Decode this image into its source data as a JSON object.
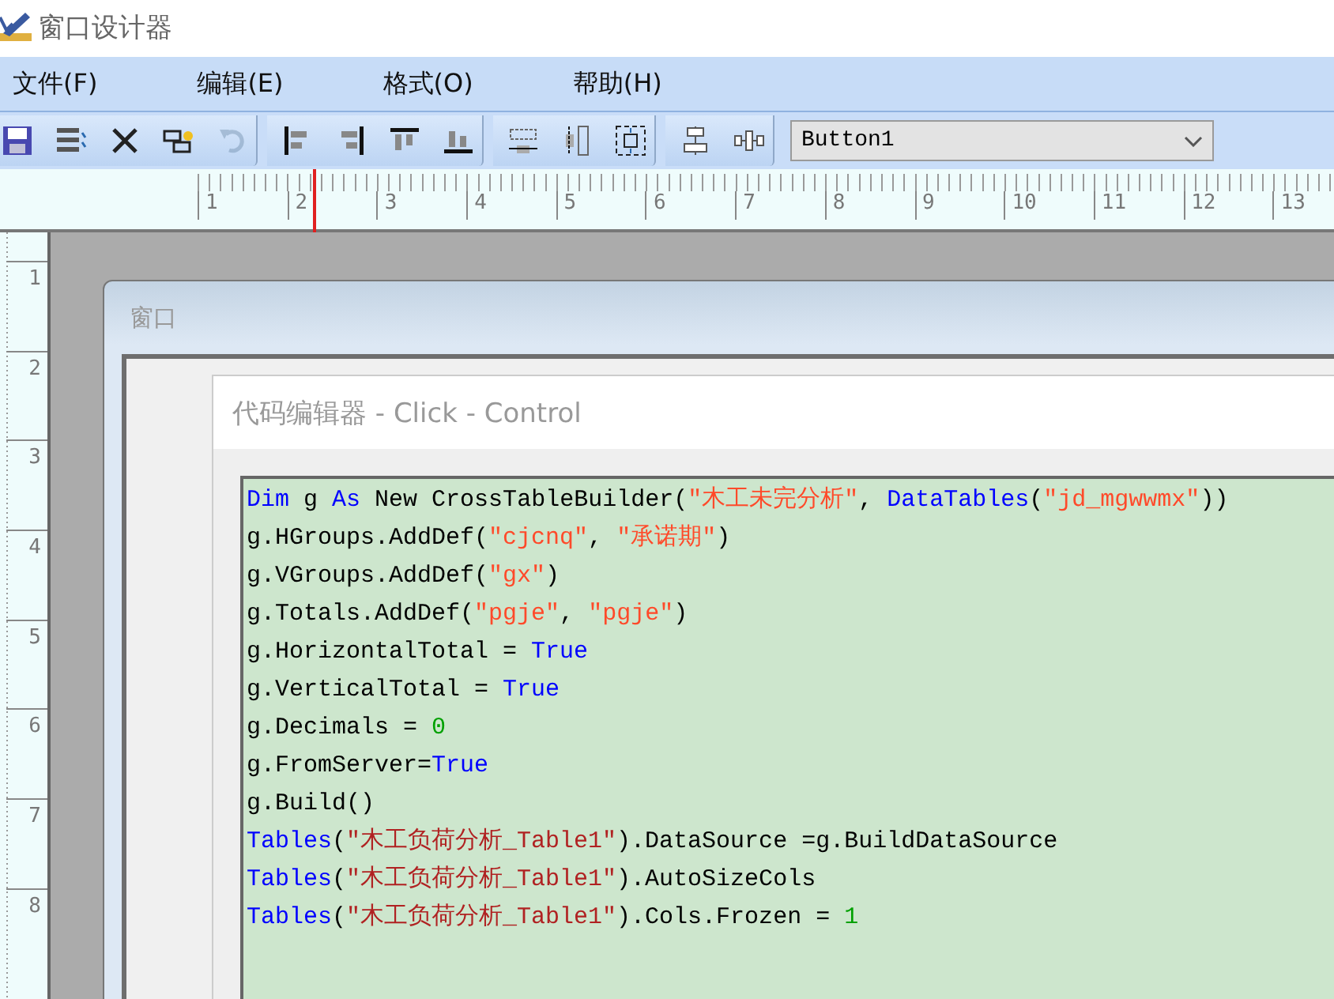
{
  "window": {
    "title": "窗口设计器"
  },
  "menu": [
    {
      "label": "文件(F)"
    },
    {
      "label": "编辑(E)"
    },
    {
      "label": "格式(O)"
    },
    {
      "label": "帮助(H)"
    }
  ],
  "toolbar": [
    [
      {
        "kind": "save",
        "disabled": false
      },
      {
        "kind": "properties",
        "disabled": false
      },
      {
        "kind": "delete",
        "disabled": false
      },
      {
        "kind": "tab-order",
        "disabled": false
      },
      {
        "kind": "undo",
        "disabled": true
      }
    ],
    [
      {
        "kind": "align-left",
        "disabled": false
      },
      {
        "kind": "align-right",
        "disabled": false
      },
      {
        "kind": "align-top",
        "disabled": false
      },
      {
        "kind": "align-bottom",
        "disabled": false
      }
    ],
    [
      {
        "kind": "same-width",
        "disabled": false
      },
      {
        "kind": "same-height",
        "disabled": false
      },
      {
        "kind": "same-size",
        "disabled": false
      }
    ],
    [
      {
        "kind": "center-vertical",
        "disabled": false
      },
      {
        "kind": "center-horizontal",
        "disabled": false
      }
    ]
  ],
  "control_selector": {
    "value": "Button1"
  },
  "ruler": {
    "horizontal": [
      "1",
      "2",
      "3",
      "4",
      "5",
      "6",
      "7",
      "8",
      "9",
      "10",
      "11",
      "12",
      "13"
    ],
    "vertical": [
      "1",
      "2",
      "3",
      "4",
      "5",
      "6",
      "7",
      "8"
    ]
  },
  "form": {
    "title": "窗口"
  },
  "code_editor": {
    "title": "代码编辑器 - Click - Control",
    "lines": [
      [
        {
          "kind": "keyword",
          "text": "Dim"
        },
        {
          "kind": "plain",
          "text": " g "
        },
        {
          "kind": "keyword",
          "text": "As"
        },
        {
          "kind": "plain",
          "text": " New CrossTableBuilder("
        },
        {
          "kind": "string",
          "text": "\"木工未完分析\""
        },
        {
          "kind": "plain",
          "text": ", "
        },
        {
          "kind": "keyword",
          "text": "DataTables"
        },
        {
          "kind": "plain",
          "text": "("
        },
        {
          "kind": "string",
          "text": "\"jd_mgwwmx\""
        },
        {
          "kind": "plain",
          "text": "))"
        }
      ],
      [
        {
          "kind": "plain",
          "text": "g.HGroups.AddDef("
        },
        {
          "kind": "string",
          "text": "\"cjcnq\""
        },
        {
          "kind": "plain",
          "text": ", "
        },
        {
          "kind": "string",
          "text": "\"承诺期\""
        },
        {
          "kind": "plain",
          "text": ")"
        }
      ],
      [
        {
          "kind": "plain",
          "text": "g.VGroups.AddDef("
        },
        {
          "kind": "string",
          "text": "\"gx\""
        },
        {
          "kind": "plain",
          "text": ")"
        }
      ],
      [
        {
          "kind": "plain",
          "text": "g.Totals.AddDef("
        },
        {
          "kind": "string",
          "text": "\"pgje\""
        },
        {
          "kind": "plain",
          "text": ", "
        },
        {
          "kind": "string",
          "text": "\"pgje\""
        },
        {
          "kind": "plain",
          "text": ")"
        }
      ],
      [
        {
          "kind": "plain",
          "text": "g.HorizontalTotal = "
        },
        {
          "kind": "keyword",
          "text": "True"
        }
      ],
      [
        {
          "kind": "plain",
          "text": "g.VerticalTotal = "
        },
        {
          "kind": "keyword",
          "text": "True"
        }
      ],
      [
        {
          "kind": "plain",
          "text": "g.Decimals = "
        },
        {
          "kind": "number",
          "text": "0"
        }
      ],
      [
        {
          "kind": "plain",
          "text": "g.FromServer="
        },
        {
          "kind": "keyword",
          "text": "True"
        }
      ],
      [
        {
          "kind": "plain",
          "text": "g.Build()"
        }
      ],
      [
        {
          "kind": "keyword",
          "text": "Tables"
        },
        {
          "kind": "plain",
          "text": "("
        },
        {
          "kind": "table-string",
          "text": "\"木工负荷分析_Table1\""
        },
        {
          "kind": "plain",
          "text": ").DataSource =g.BuildDataSource"
        }
      ],
      [
        {
          "kind": "keyword",
          "text": "Tables"
        },
        {
          "kind": "plain",
          "text": "("
        },
        {
          "kind": "table-string",
          "text": "\"木工负荷分析_Table1\""
        },
        {
          "kind": "plain",
          "text": ").AutoSizeCols"
        }
      ],
      [
        {
          "kind": "keyword",
          "text": "Tables"
        },
        {
          "kind": "plain",
          "text": "("
        },
        {
          "kind": "table-string",
          "text": "\"木工负荷分析_Table1\""
        },
        {
          "kind": "plain",
          "text": ").Cols.Frozen = "
        },
        {
          "kind": "number",
          "text": "1"
        }
      ]
    ]
  }
}
